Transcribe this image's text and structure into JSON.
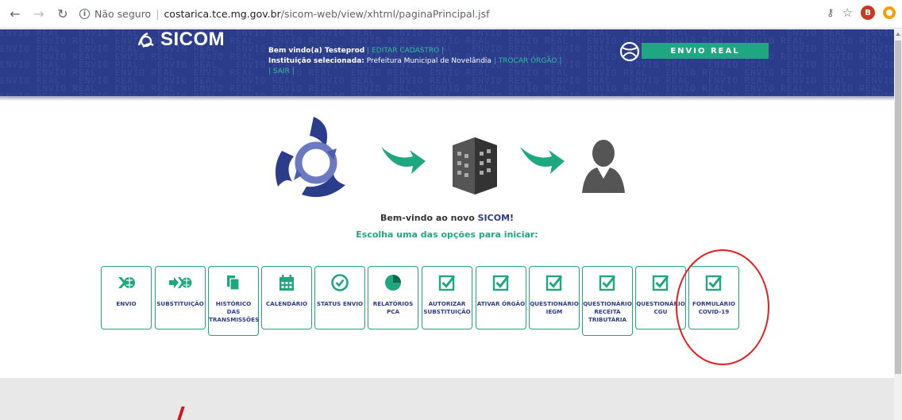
{
  "browser": {
    "not_secure": "Não seguro",
    "url_host": "costarica.tce.mg.gov.br",
    "url_path": "/sicom-web/view/xhtml/paginaPrincipal.jsf",
    "avatar_letter": "B"
  },
  "header": {
    "logo_text": "SICOM",
    "greeting_prefix": "Bem vindo(a) Testeprod",
    "edit_link": "| EDITAR CADASTRO |",
    "institution_label": "Instituição selecionada:",
    "institution_value": "Prefeitura Municipal de Novelândia",
    "switch_link": "| TROCAR ÓRGÃO |",
    "logout_link": "| SAIR |",
    "mode_badge": "ENVIO REAL",
    "watermark_word": "ENVIO REAL"
  },
  "main": {
    "welcome_prefix": "Bem-vindo ao novo ",
    "welcome_brand": "SICOM",
    "welcome_suffix": "!",
    "choose": "Escolha uma das opções para iniciar:"
  },
  "options": [
    {
      "label": "ENVIO",
      "icon": "globe-arrow-icon"
    },
    {
      "label": "SUBSTITUIÇÃO",
      "icon": "arrow-globe-icon"
    },
    {
      "label": "HISTÓRICO DAS TRANSMISSÕES",
      "icon": "documents-icon"
    },
    {
      "label": "CALENDÁRIO",
      "icon": "calendar-icon"
    },
    {
      "label": "STATUS ENVIO",
      "icon": "status-check-icon"
    },
    {
      "label": "RELATÓRIOS PCA",
      "icon": "pie-chart-icon"
    },
    {
      "label": "AUTORIZAR SUBSTITUIÇÃO",
      "icon": "checkbox-icon"
    },
    {
      "label": "ATIVAR ÓRGÃO",
      "icon": "checkbox-icon"
    },
    {
      "label": "QUESTIONÁRIO IEGM",
      "icon": "checkbox-icon"
    },
    {
      "label": "QUESTIONÁRIO RECEITA TRIBUTÁRIA",
      "icon": "checkbox-icon"
    },
    {
      "label": "QUESTIONÁRIO CGU",
      "icon": "checkbox-icon"
    },
    {
      "label": "FORMULÁRIO COVID-19",
      "icon": "checkbox-icon"
    }
  ],
  "colors": {
    "brand_blue": "#2b3c8a",
    "accent_green": "#1fa77f",
    "annotation_red": "#e02020"
  }
}
